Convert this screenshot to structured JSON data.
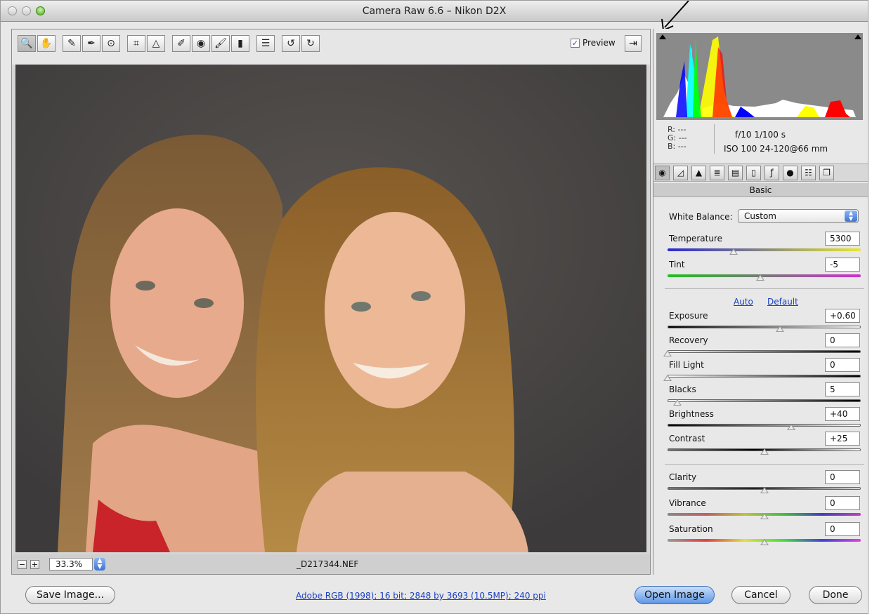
{
  "window": {
    "title": "Camera Raw 6.6  –  Nikon D2X"
  },
  "toolbar": {
    "tools": [
      "zoom-tool",
      "hand-tool",
      "white-balance-tool",
      "color-sampler-tool",
      "targeted-adjustment-tool",
      "crop-tool",
      "straighten-tool",
      "spot-removal-tool",
      "red-eye-removal-tool",
      "adjustment-brush-tool",
      "graduated-filter-tool",
      "preferences-tool",
      "rotate-ccw-tool",
      "rotate-cw-tool"
    ],
    "preview_label": "Preview",
    "preview_checked": true
  },
  "image": {
    "filename": "_D217344.NEF"
  },
  "zoom": {
    "value": "33.3%"
  },
  "readout": {
    "r": "R:  ---",
    "g": "G:  ---",
    "b": "B:  ---",
    "exif_line1": "f/10   1/100 s",
    "exif_line2": "ISO 100   24-120@66 mm"
  },
  "panel": {
    "name": "Basic",
    "tabs": [
      "basic-icon",
      "tone-curve-icon",
      "detail-icon",
      "hsl-icon",
      "split-toning-icon",
      "lens-corrections-icon",
      "effects-icon",
      "camera-calibration-icon",
      "presets-icon",
      "snapshots-icon"
    ],
    "white_balance": {
      "label": "White Balance:",
      "value": "Custom"
    },
    "links": {
      "auto": "Auto",
      "default": "Default"
    },
    "sliders": [
      {
        "id": "temperature",
        "label": "Temperature",
        "value": "5300",
        "pos": 0.34
      },
      {
        "id": "tint",
        "label": "Tint",
        "value": "-5",
        "pos": 0.48
      },
      {
        "id": "exposure",
        "label": "Exposure",
        "value": "+0.60",
        "pos": 0.58
      },
      {
        "id": "recovery",
        "label": "Recovery",
        "value": "0",
        "pos": 0.0
      },
      {
        "id": "fill-light",
        "label": "Fill Light",
        "value": "0",
        "pos": 0.0
      },
      {
        "id": "blacks",
        "label": "Blacks",
        "value": "5",
        "pos": 0.05
      },
      {
        "id": "brightness",
        "label": "Brightness",
        "value": "+40",
        "pos": 0.64
      },
      {
        "id": "contrast",
        "label": "Contrast",
        "value": "+25",
        "pos": 0.5
      },
      {
        "id": "clarity",
        "label": "Clarity",
        "value": "0",
        "pos": 0.5
      },
      {
        "id": "vibrance",
        "label": "Vibrance",
        "value": "0",
        "pos": 0.5
      },
      {
        "id": "saturation",
        "label": "Saturation",
        "value": "0",
        "pos": 0.5
      }
    ]
  },
  "footer": {
    "save_label": "Save Image...",
    "docinfo": "Adobe RGB (1998); 16 bit; 2848 by 3693 (10.5MP); 240 ppi",
    "open_label": "Open Image",
    "cancel_label": "Cancel",
    "done_label": "Done"
  },
  "colors": {
    "accent": "#3a74d8",
    "link": "#1a3fbf"
  }
}
